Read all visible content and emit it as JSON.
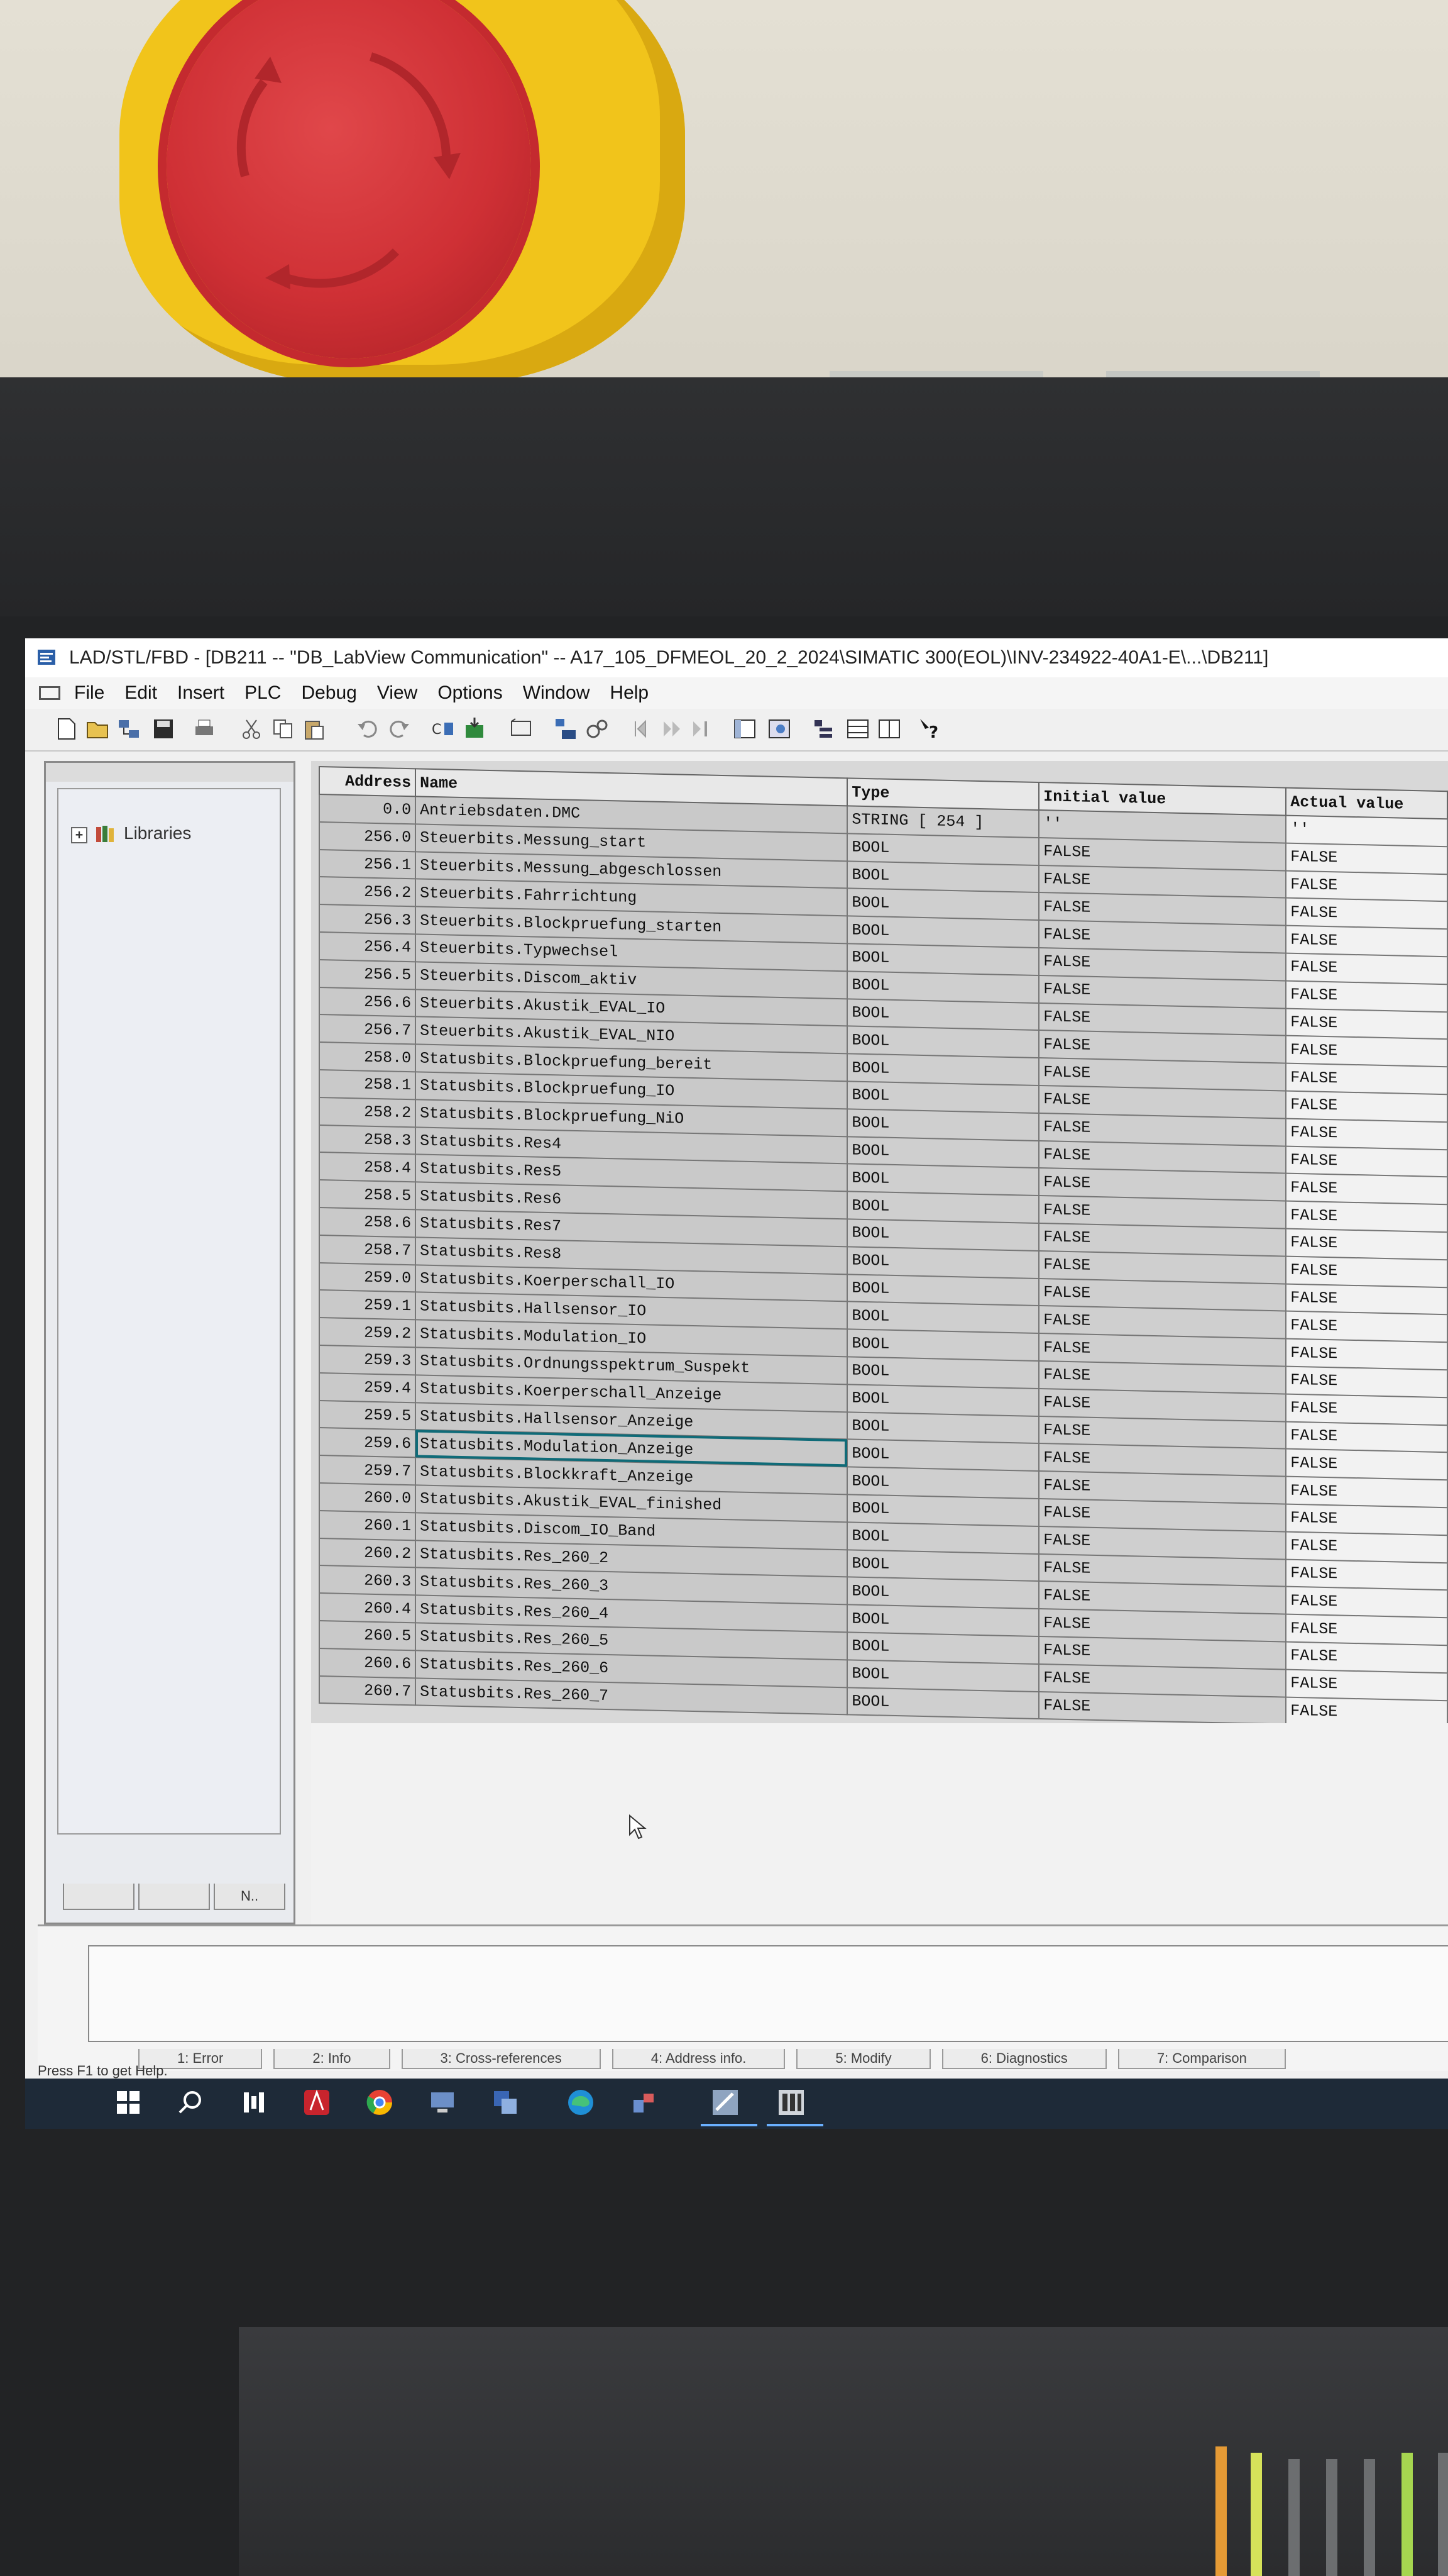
{
  "window": {
    "title": "LAD/STL/FBD  - [DB211 -- \"DB_LabView Communication\" -- A17_105_DFMEOL_20_2_2024\\SIMATIC 300(EOL)\\INV-234922-40A1-E\\...\\DB211]"
  },
  "menu": {
    "items": [
      "File",
      "Edit",
      "Insert",
      "PLC",
      "Debug",
      "View",
      "Options",
      "Window",
      "Help"
    ]
  },
  "toolbar": {
    "icons": [
      "new-icon",
      "open-icon",
      "accessible-nodes-icon",
      "save-icon",
      "print-icon",
      "cut-icon",
      "copy-icon",
      "paste-icon",
      "undo-icon",
      "redo-icon",
      "compile-icon",
      "download-icon",
      "monitor-icon",
      "module-info-icon",
      "go-online-icon",
      "breakpoint-icon",
      "step-icon",
      "overview-icon",
      "library-view-icon",
      "details-icon",
      "table-view-icon",
      "declaration-view-icon",
      "help-icon"
    ]
  },
  "left_panel": {
    "tree": [
      {
        "label": "Libraries",
        "expander": "+"
      }
    ],
    "tabs": [
      "",
      "",
      "N.."
    ]
  },
  "table": {
    "headers": {
      "address": "Address",
      "name": "Name",
      "type": "Type",
      "initial": "Initial value",
      "actual": "Actual value"
    },
    "rows": [
      {
        "address": "0.0",
        "name": "Antriebsdaten.DMC",
        "type": "STRING [ 254 ]",
        "initial": "''",
        "actual": "''"
      },
      {
        "address": "256.0",
        "name": "Steuerbits.Messung_start",
        "type": "BOOL",
        "initial": "FALSE",
        "actual": "FALSE"
      },
      {
        "address": "256.1",
        "name": "Steuerbits.Messung_abgeschlossen",
        "type": "BOOL",
        "initial": "FALSE",
        "actual": "FALSE"
      },
      {
        "address": "256.2",
        "name": "Steuerbits.Fahrrichtung",
        "type": "BOOL",
        "initial": "FALSE",
        "actual": "FALSE"
      },
      {
        "address": "256.3",
        "name": "Steuerbits.Blockpruefung_starten",
        "type": "BOOL",
        "initial": "FALSE",
        "actual": "FALSE"
      },
      {
        "address": "256.4",
        "name": "Steuerbits.Typwechsel",
        "type": "BOOL",
        "initial": "FALSE",
        "actual": "FALSE"
      },
      {
        "address": "256.5",
        "name": "Steuerbits.Discom_aktiv",
        "type": "BOOL",
        "initial": "FALSE",
        "actual": "FALSE"
      },
      {
        "address": "256.6",
        "name": "Steuerbits.Akustik_EVAL_IO",
        "type": "BOOL",
        "initial": "FALSE",
        "actual": "FALSE"
      },
      {
        "address": "256.7",
        "name": "Steuerbits.Akustik_EVAL_NIO",
        "type": "BOOL",
        "initial": "FALSE",
        "actual": "FALSE"
      },
      {
        "address": "258.0",
        "name": "Statusbits.Blockpruefung_bereit",
        "type": "BOOL",
        "initial": "FALSE",
        "actual": "FALSE"
      },
      {
        "address": "258.1",
        "name": "Statusbits.Blockpruefung_IO",
        "type": "BOOL",
        "initial": "FALSE",
        "actual": "FALSE"
      },
      {
        "address": "258.2",
        "name": "Statusbits.Blockpruefung_NiO",
        "type": "BOOL",
        "initial": "FALSE",
        "actual": "FALSE"
      },
      {
        "address": "258.3",
        "name": "Statusbits.Res4",
        "type": "BOOL",
        "initial": "FALSE",
        "actual": "FALSE"
      },
      {
        "address": "258.4",
        "name": "Statusbits.Res5",
        "type": "BOOL",
        "initial": "FALSE",
        "actual": "FALSE"
      },
      {
        "address": "258.5",
        "name": "Statusbits.Res6",
        "type": "BOOL",
        "initial": "FALSE",
        "actual": "FALSE"
      },
      {
        "address": "258.6",
        "name": "Statusbits.Res7",
        "type": "BOOL",
        "initial": "FALSE",
        "actual": "FALSE"
      },
      {
        "address": "258.7",
        "name": "Statusbits.Res8",
        "type": "BOOL",
        "initial": "FALSE",
        "actual": "FALSE"
      },
      {
        "address": "259.0",
        "name": "Statusbits.Koerperschall_IO",
        "type": "BOOL",
        "initial": "FALSE",
        "actual": "FALSE"
      },
      {
        "address": "259.1",
        "name": "Statusbits.Hallsensor_IO",
        "type": "BOOL",
        "initial": "FALSE",
        "actual": "FALSE"
      },
      {
        "address": "259.2",
        "name": "Statusbits.Modulation_IO",
        "type": "BOOL",
        "initial": "FALSE",
        "actual": "FALSE"
      },
      {
        "address": "259.3",
        "name": "Statusbits.Ordnungsspektrum_Suspekt",
        "type": "BOOL",
        "initial": "FALSE",
        "actual": "FALSE"
      },
      {
        "address": "259.4",
        "name": "Statusbits.Koerperschall_Anzeige",
        "type": "BOOL",
        "initial": "FALSE",
        "actual": "FALSE"
      },
      {
        "address": "259.5",
        "name": "Statusbits.Hallsensor_Anzeige",
        "type": "BOOL",
        "initial": "FALSE",
        "actual": "FALSE"
      },
      {
        "address": "259.6",
        "name": "Statusbits.Modulation_Anzeige",
        "type": "BOOL",
        "initial": "FALSE",
        "actual": "FALSE",
        "selected": true
      },
      {
        "address": "259.7",
        "name": "Statusbits.Blockkraft_Anzeige",
        "type": "BOOL",
        "initial": "FALSE",
        "actual": "FALSE"
      },
      {
        "address": "260.0",
        "name": "Statusbits.Akustik_EVAL_finished",
        "type": "BOOL",
        "initial": "FALSE",
        "actual": "FALSE"
      },
      {
        "address": "260.1",
        "name": "Statusbits.Discom_IO_Band",
        "type": "BOOL",
        "initial": "FALSE",
        "actual": "FALSE"
      },
      {
        "address": "260.2",
        "name": "Statusbits.Res_260_2",
        "type": "BOOL",
        "initial": "FALSE",
        "actual": "FALSE"
      },
      {
        "address": "260.3",
        "name": "Statusbits.Res_260_3",
        "type": "BOOL",
        "initial": "FALSE",
        "actual": "FALSE"
      },
      {
        "address": "260.4",
        "name": "Statusbits.Res_260_4",
        "type": "BOOL",
        "initial": "FALSE",
        "actual": "FALSE"
      },
      {
        "address": "260.5",
        "name": "Statusbits.Res_260_5",
        "type": "BOOL",
        "initial": "FALSE",
        "actual": "FALSE"
      },
      {
        "address": "260.6",
        "name": "Statusbits.Res_260_6",
        "type": "BOOL",
        "initial": "FALSE",
        "actual": "FALSE"
      },
      {
        "address": "260.7",
        "name": "Statusbits.Res_260_7",
        "type": "BOOL",
        "initial": "FALSE",
        "actual": "FALSE"
      }
    ]
  },
  "details": {
    "tabs": [
      "1: Error",
      "2: Info",
      "3: Cross-references",
      "4: Address info.",
      "5: Modify",
      "6: Diagnostics",
      "7: Comparison"
    ]
  },
  "status_bar": {
    "text": "Press F1 to get Help."
  },
  "taskbar": {
    "icons": [
      "windows-start-icon",
      "search-icon",
      "task-view-icon",
      "acrobat-icon",
      "chrome-icon",
      "network-icon",
      "simatic-manager-icon",
      "edge-icon",
      "tools-icon",
      "lad-stl-fbd-icon",
      "hw-config-icon"
    ]
  },
  "colors": {
    "selection": "#0f6b78",
    "estop_red": "#cf3035",
    "estop_yellow": "#f1c41b"
  }
}
